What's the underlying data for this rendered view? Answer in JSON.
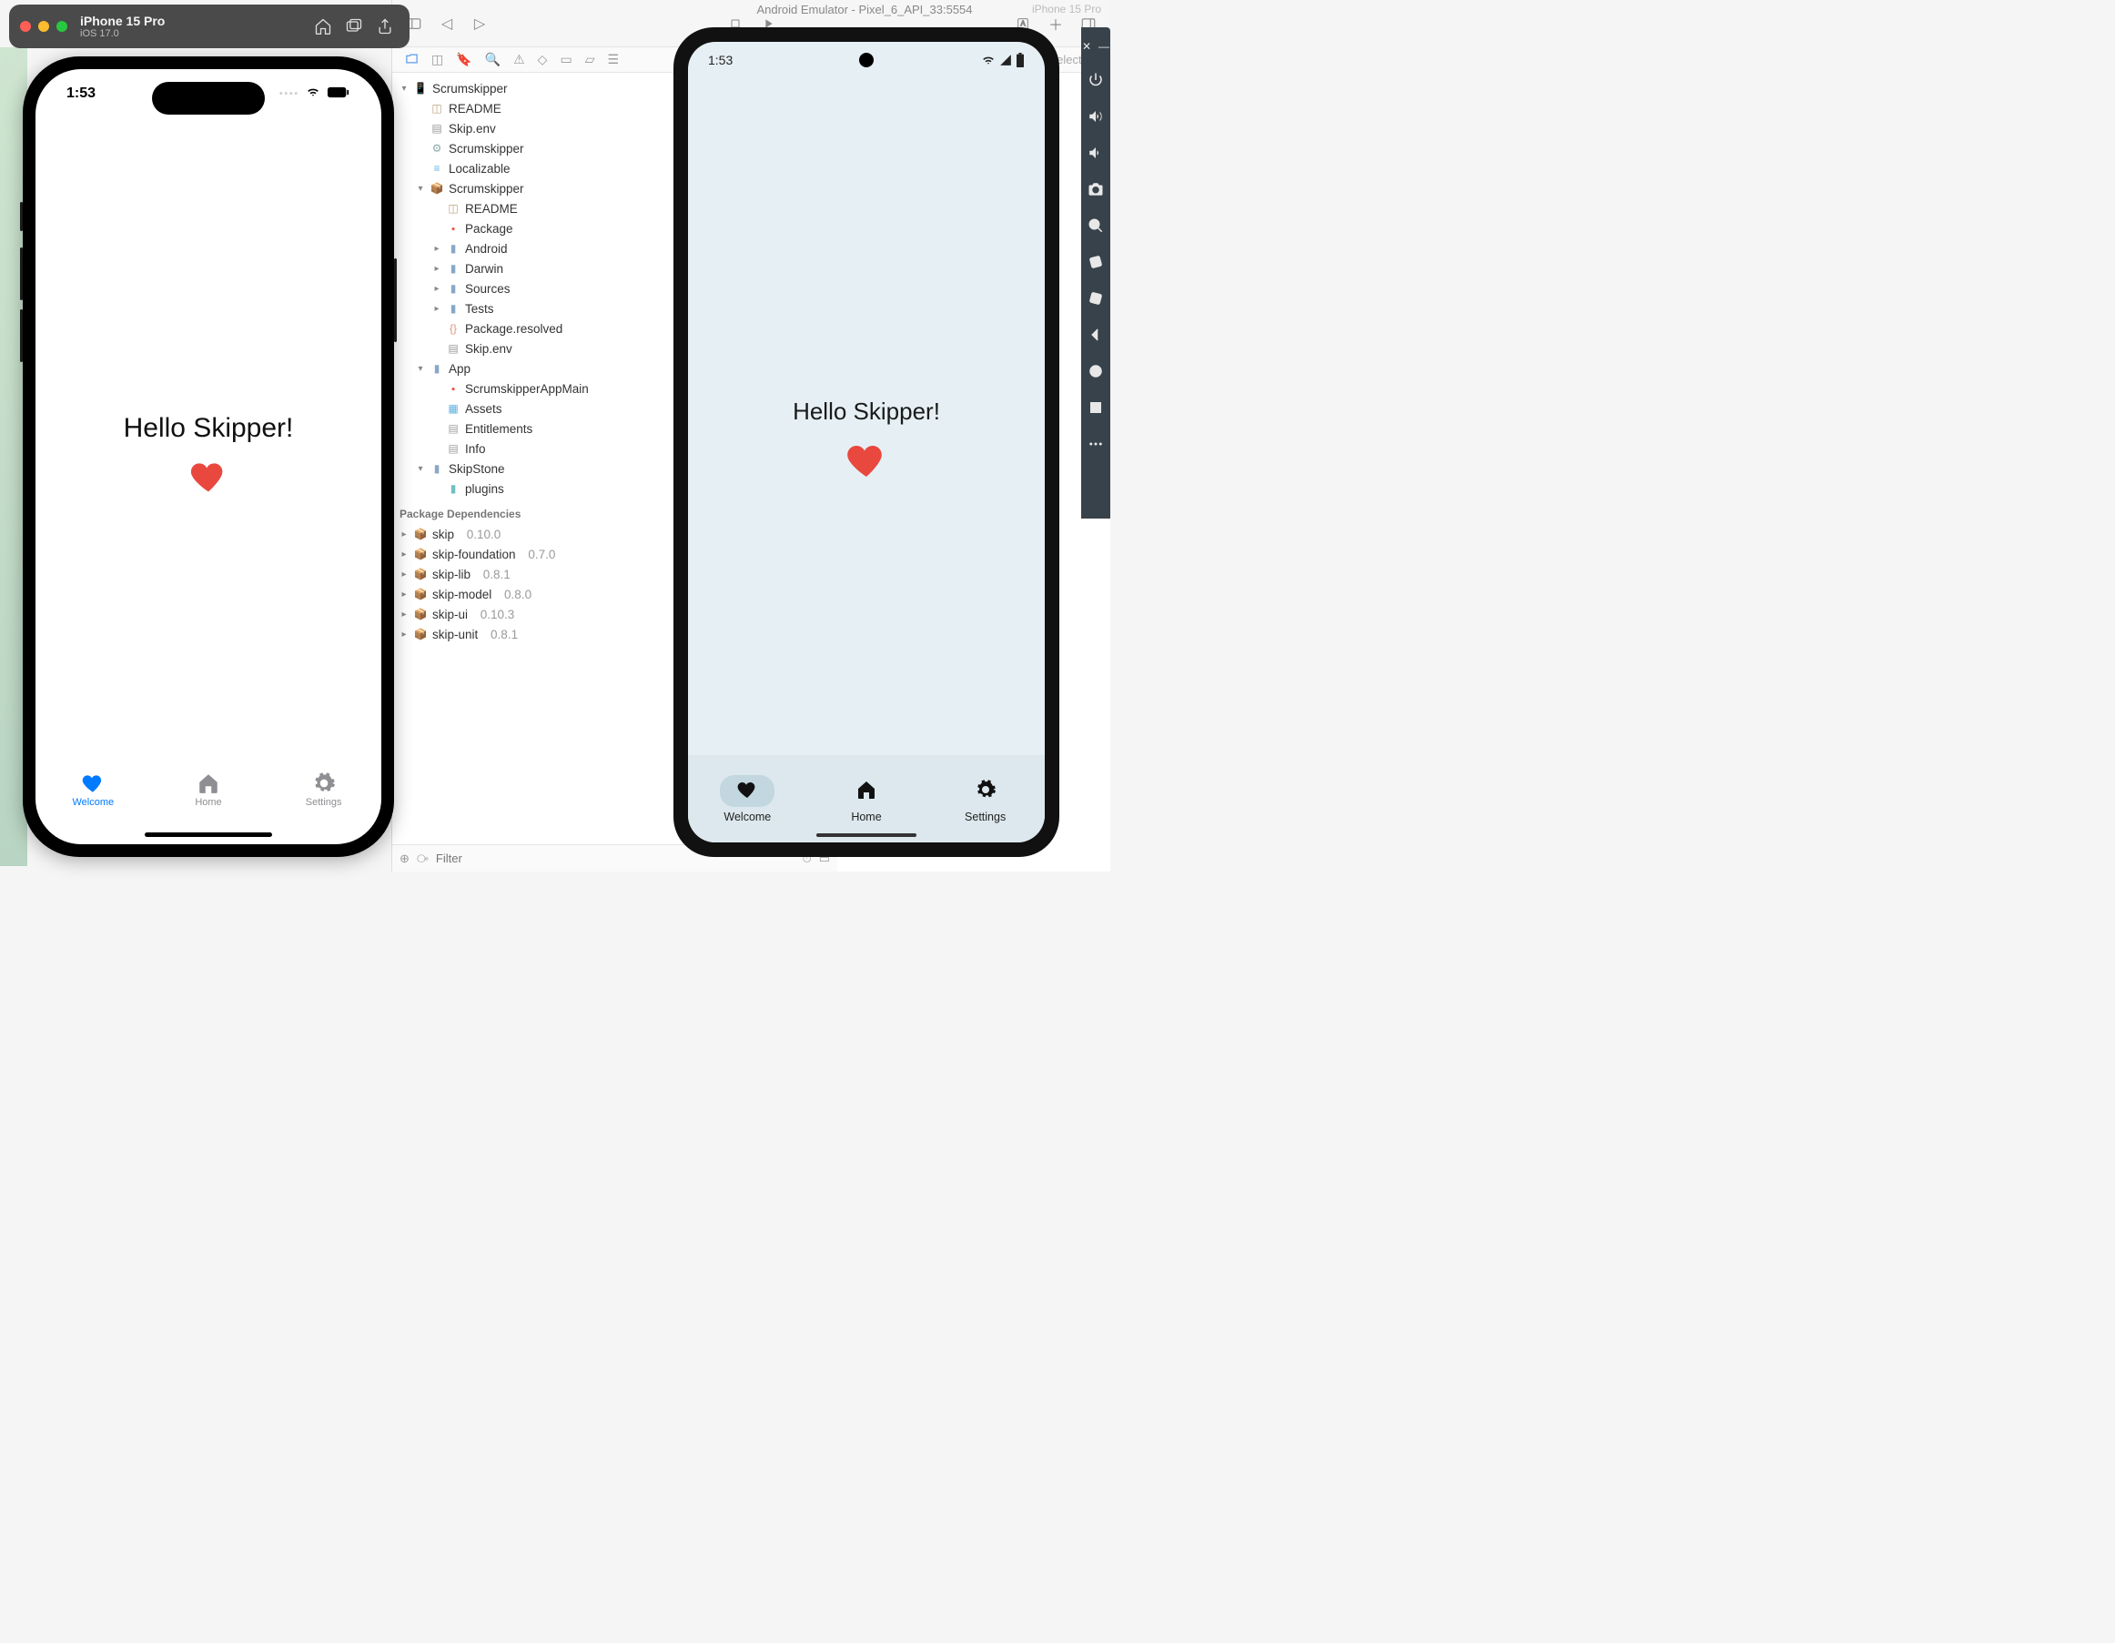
{
  "ios_chrome": {
    "device_name": "iPhone 15 Pro",
    "os_version": "iOS 17.0"
  },
  "ios_status": {
    "time": "1:53"
  },
  "android_title": "Android Emulator - Pixel_6_API_33:5554",
  "android_status": {
    "time": "1:53"
  },
  "ghost_label": "iPhone 15 Pro",
  "app": {
    "hello_text": "Hello Skipper!",
    "tabs": {
      "welcome": "Welcome",
      "home": "Home",
      "settings": "Settings"
    }
  },
  "xcode": {
    "no_selection": "No Selection",
    "filter_placeholder": "Filter",
    "tree": {
      "root": "Scrumskipper",
      "readme1": "README",
      "skipenv1": "Skip.env",
      "target": "Scrumskipper",
      "localizable": "Localizable",
      "pkg_group": "Scrumskipper",
      "readme2": "README",
      "package": "Package",
      "android": "Android",
      "darwin": "Darwin",
      "sources": "Sources",
      "tests": "Tests",
      "pkg_resolved": "Package.resolved",
      "skipenv2": "Skip.env",
      "app_group": "App",
      "app_main": "ScrumskipperAppMain",
      "assets": "Assets",
      "entitlements": "Entitlements",
      "info": "Info",
      "skipstone": "SkipStone",
      "plugins": "plugins"
    },
    "deps_header": "Package Dependencies",
    "deps": [
      {
        "name": "skip",
        "ver": "0.10.0"
      },
      {
        "name": "skip-foundation",
        "ver": "0.7.0"
      },
      {
        "name": "skip-lib",
        "ver": "0.8.1"
      },
      {
        "name": "skip-model",
        "ver": "0.8.0"
      },
      {
        "name": "skip-ui",
        "ver": "0.10.3"
      },
      {
        "name": "skip-unit",
        "ver": "0.8.1"
      }
    ]
  }
}
